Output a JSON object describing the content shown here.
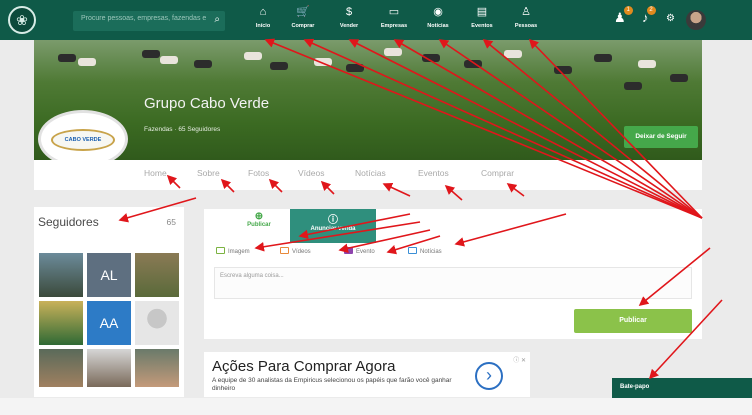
{
  "topnav": {
    "search_placeholder": "Procure pessoas, empresas, fazendas e",
    "items": [
      {
        "label": "Início",
        "icon": "home-icon",
        "glyph": "⌂"
      },
      {
        "label": "Comprar",
        "icon": "cart-icon",
        "glyph": "🛒"
      },
      {
        "label": "Vender",
        "icon": "dollar-icon",
        "glyph": "$"
      },
      {
        "label": "Empresas",
        "icon": "briefcase-icon",
        "glyph": "▭"
      },
      {
        "label": "Notícias",
        "icon": "news-icon",
        "glyph": "◉"
      },
      {
        "label": "Eventos",
        "icon": "calendar-icon",
        "glyph": "▤"
      },
      {
        "label": "Pessoas",
        "icon": "person-icon",
        "glyph": "♙"
      }
    ],
    "badges": [
      "1",
      "2"
    ]
  },
  "profile": {
    "name": "Grupo Cabo Verde",
    "subtitle": "Fazendas · 65 Seguidores",
    "logo_text": "CABO VERDE",
    "unfollow_label": "Deixar de Seguir"
  },
  "tabs": [
    "Home",
    "Sobre",
    "Fotos",
    "Vídeos",
    "Notícias",
    "Eventos",
    "Comprar"
  ],
  "followers": {
    "title": "Seguidores",
    "count": "65",
    "initials": [
      "AL",
      "AA"
    ]
  },
  "composer": {
    "tab_publish": "Publicar",
    "tab_sale": "Anunciar venda",
    "attachments": [
      {
        "label": "Imagem",
        "color": "#7cb342"
      },
      {
        "label": "Vídeos",
        "color": "#e8893a"
      },
      {
        "label": "Evento",
        "color": "#8e44ad"
      },
      {
        "label": "Notícias",
        "color": "#3b8fd6"
      }
    ],
    "placeholder": "Escreva alguma coisa...",
    "publish_label": "Publicar"
  },
  "ad": {
    "title": "Ações Para Comprar Agora",
    "body": "A equipe de 30 analistas da Empiricus selecionou os papéis que farão você ganhar dinheiro",
    "close": "ⓘ ✕"
  },
  "chat": {
    "label": "Bate-papo"
  },
  "colors": {
    "nav": "#0f5a48",
    "accent": "#45a84a",
    "publish": "#8bc24a",
    "arrow": "#e0161b"
  }
}
